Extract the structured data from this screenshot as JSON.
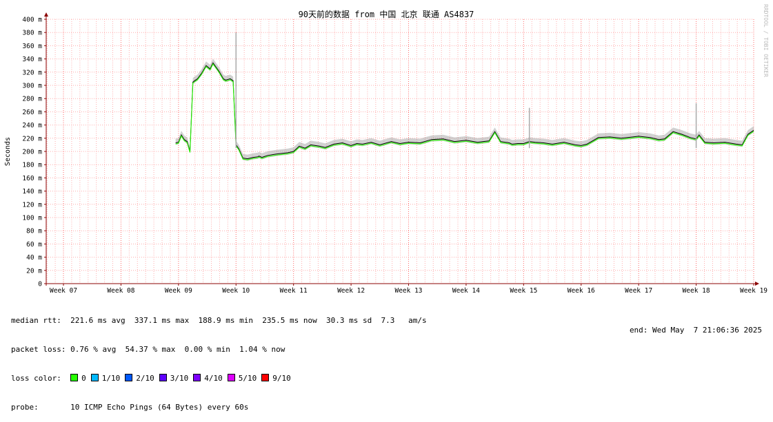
{
  "chart_data": {
    "type": "line",
    "title": "90天前的数据 from 中国 北京 联通 AS4837",
    "ylabel": "Seconds",
    "ylim": [
      0,
      400
    ],
    "y_ticks": [
      "0",
      "20 m",
      "40 m",
      "60 m",
      "80 m",
      "100 m",
      "120 m",
      "140 m",
      "160 m",
      "180 m",
      "200 m",
      "220 m",
      "240 m",
      "260 m",
      "280 m",
      "300 m",
      "320 m",
      "340 m",
      "360 m",
      "380 m",
      "400 m"
    ],
    "x_ticks": [
      "Week 07",
      "Week 08",
      "Week 09",
      "Week 10",
      "Week 11",
      "Week 12",
      "Week 13",
      "Week 14",
      "Week 15",
      "Week 16",
      "Week 17",
      "Week 18",
      "Week 19"
    ],
    "xlim_weeks": [
      6.7,
      19.0
    ],
    "grid": true,
    "series": [
      {
        "units": "ms",
        "x_week": [
          8.95,
          9.0,
          9.05,
          9.1,
          9.15,
          9.2,
          9.25,
          9.28,
          9.33,
          9.4,
          9.48,
          9.55,
          9.6,
          9.7,
          9.78,
          9.82,
          9.9,
          9.95,
          10.0,
          10.05,
          10.12,
          10.2,
          10.3,
          10.38,
          10.4,
          10.45,
          10.55,
          10.7,
          10.9,
          11.0,
          11.1,
          11.2,
          11.3,
          11.45,
          11.55,
          11.7,
          11.85,
          12.0,
          12.1,
          12.2,
          12.35,
          12.5,
          12.7,
          12.85,
          13.0,
          13.2,
          13.4,
          13.6,
          13.8,
          14.0,
          14.2,
          14.4,
          14.5,
          14.6,
          14.75,
          14.8,
          14.9,
          15.0,
          15.1,
          15.2,
          15.35,
          15.5,
          15.7,
          15.9,
          16.0,
          16.1,
          16.3,
          16.5,
          16.7,
          16.9,
          17.0,
          17.2,
          17.35,
          17.45,
          17.6,
          17.75,
          17.9,
          18.0,
          18.05,
          18.15,
          18.3,
          18.5,
          18.7,
          18.8,
          18.9,
          19.0
        ],
        "y_ms": [
          213,
          214,
          225,
          218,
          215,
          200,
          305,
          307,
          310,
          318,
          330,
          325,
          334,
          322,
          310,
          308,
          310,
          307,
          210,
          204,
          190,
          189,
          191,
          192,
          193,
          191,
          194,
          196,
          198,
          200,
          208,
          205,
          210,
          208,
          206,
          211,
          213,
          209,
          212,
          211,
          214,
          210,
          215,
          212,
          214,
          213,
          218,
          219,
          215,
          217,
          214,
          216,
          230,
          215,
          213,
          211,
          212,
          212,
          215,
          214,
          213,
          211,
          214,
          210,
          209,
          211,
          221,
          222,
          220,
          222,
          223,
          221,
          218,
          219,
          230,
          226,
          221,
          219,
          225,
          214,
          213,
          214,
          211,
          210,
          226,
          232
        ]
      }
    ],
    "spikes": [
      {
        "x_week": 10.0,
        "y_ms": 380
      },
      {
        "x_week": 15.1,
        "y_ms": 266
      },
      {
        "x_week": 18.0,
        "y_ms": 273
      }
    ]
  },
  "stats": {
    "median_rtt_label": "median rtt:",
    "median_rtt_value": "221.6 ms avg  337.1 ms max  188.9 ms min  235.5 ms now  30.3 ms sd  7.3   am/s",
    "packet_loss_label": "packet loss:",
    "packet_loss_value": "0.76 % avg  54.37 % max  0.00 % min  1.04 % now",
    "loss_color_label": "loss color:",
    "loss_colors": [
      {
        "label": "0",
        "color": "#26ff00"
      },
      {
        "label": "1/10",
        "color": "#00b8ff"
      },
      {
        "label": "2/10",
        "color": "#0059ff"
      },
      {
        "label": "3/10",
        "color": "#5e00ff"
      },
      {
        "label": "4/10",
        "color": "#7e00ff"
      },
      {
        "label": "5/10",
        "color": "#dd00ff"
      },
      {
        "label": "9/10",
        "color": "#ff0000"
      }
    ],
    "probe_label": "probe:",
    "probe_value": "10 ICMP Echo Pings (64 Bytes) every 60s",
    "end_time": "end: Wed May  7 21:06:36 2025"
  },
  "credit": "RRDTOOL / TOBI OETIKER",
  "colors": {
    "median_line": "#000000",
    "smoke": "#999999",
    "grid_minor": "#ffaaaa",
    "grid_major": "#ff6666",
    "axis": "#8b0000"
  }
}
